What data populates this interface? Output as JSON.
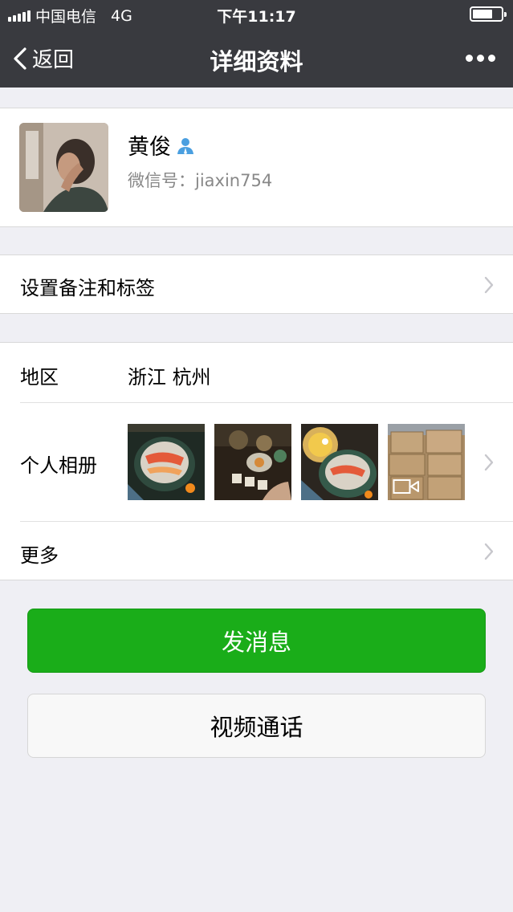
{
  "status_bar": {
    "carrier": "中国电信",
    "network": "4G",
    "time": "下午11:17",
    "battery_level": 0.7
  },
  "nav": {
    "back_label": "返回",
    "title": "详细资料",
    "more_icon": "more-dots-icon"
  },
  "profile": {
    "name": "黄俊",
    "contact_badge_icon": "person-icon",
    "wechat_id_label": "微信号：",
    "wechat_id": "jiaxin754"
  },
  "rows": {
    "remark_label": "设置备注和标签",
    "region_label": "地区",
    "region_value": "浙江 杭州",
    "album_label": "个人相册",
    "album_photos": [
      {
        "name": "sushi-platter-photo"
      },
      {
        "name": "dinner-table-photo"
      },
      {
        "name": "sashimi-hotpot-photo"
      },
      {
        "name": "boxes-video-thumbnail",
        "video": true
      }
    ],
    "more_label": "更多"
  },
  "buttons": {
    "message": "发消息",
    "video_call": "视频通话"
  },
  "colors": {
    "nav_bg": "#393a3f",
    "page_bg": "#efeff4",
    "primary_green": "#1aad19",
    "badge_blue": "#4a9fe0"
  }
}
